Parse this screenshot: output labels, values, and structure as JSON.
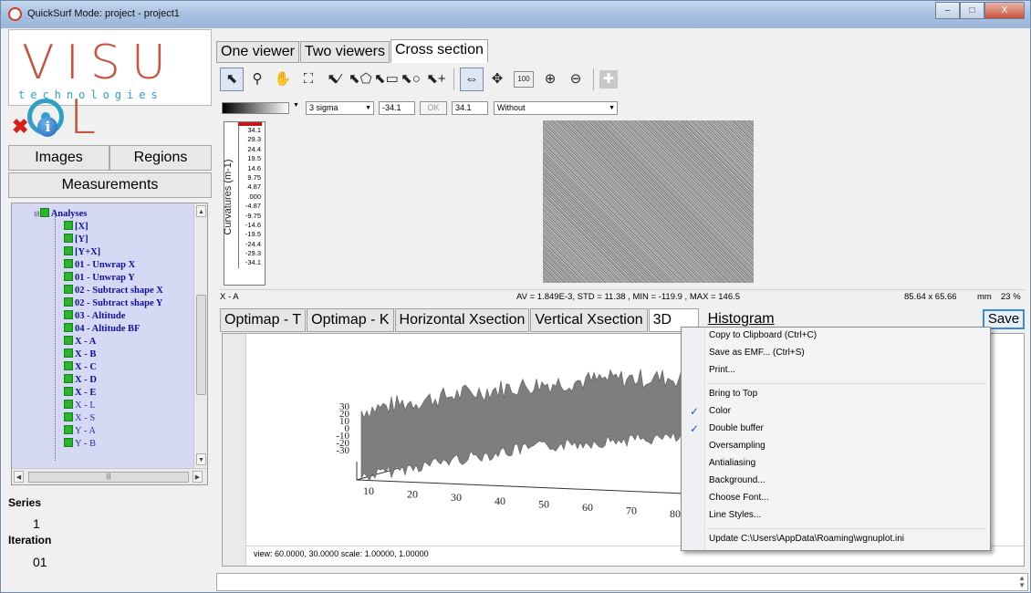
{
  "window": {
    "title": "QuickSurf Mode: project - project1",
    "buttons": {
      "minimize": "–",
      "maximize": "□",
      "close": "X"
    }
  },
  "sidebar": {
    "logo_main_left": "VISU",
    "logo_main_right": "L",
    "logo_sub": "technologies",
    "tabs": {
      "images": "Images",
      "regions": "Regions",
      "measurements": "Measurements"
    },
    "tree": {
      "root": "Analyses",
      "items": [
        "[X]",
        "[Y]",
        "[Y+X]",
        "01 - Unwrap X",
        "01 - Unwrap Y",
        "02 - Subtract shape X",
        "02 - Subtract shape Y",
        "03 - Altitude",
        "04 - Altitude BF",
        "X - A",
        "X - B",
        "X - C",
        "X - D",
        "X - E",
        "X - L",
        "X - S",
        "Y - A",
        "Y - B"
      ]
    },
    "series_label": "Series",
    "series_value": "1",
    "iteration_label": "Iteration",
    "iteration_value": "01"
  },
  "main": {
    "tabs": [
      "One viewer",
      "Two viewers",
      "Cross section"
    ],
    "active_tab": "Cross section",
    "toolbar_text_button": "100",
    "options": {
      "sigma": "3 sigma",
      "min": "-34.1",
      "ok": "OK",
      "max": "34.1",
      "filter": "Without"
    },
    "colorbar": {
      "label": "Curvatures (m-1)",
      "ticks": [
        "34.1",
        "29.3",
        "24.4",
        "19.5",
        "14.6",
        "9.75",
        "4.87",
        ".000",
        "-4.87",
        "-9.75",
        "-14.6",
        "-19.5",
        "-24.4",
        "-29.3",
        "-34.1"
      ]
    },
    "status": {
      "left": "X - A",
      "stats": "AV = 1.849E-3, STD = 11.38 , MIN = -119.9 , MAX = 146.5",
      "size": "85.64 x 65.66",
      "unit": "mm",
      "zoom": "23 %"
    },
    "subtabs": [
      "Optimap - T",
      "Optimap - K",
      "Horizontal Xsection",
      "Vertical Xsection",
      "3D",
      "Histogram"
    ],
    "active_subtab": "3D",
    "save_label": "Save",
    "plot": {
      "z_ticks": [
        "30",
        "20",
        "10",
        "0",
        "-10",
        "-20",
        "-30"
      ],
      "x_ticks": [
        "10",
        "20",
        "30",
        "40",
        "50",
        "60",
        "70",
        "80"
      ],
      "view_text": "view: 60.0000, 30.0000  scale: 1.00000, 1.00000"
    }
  },
  "context_menu": {
    "items": [
      {
        "label": "Copy to Clipboard (Ctrl+C)",
        "checked": false
      },
      {
        "label": "Save as EMF... (Ctrl+S)",
        "checked": false
      },
      {
        "label": "Print...",
        "checked": false
      },
      {
        "label": "Bring to Top",
        "checked": false
      },
      {
        "label": "Color",
        "checked": true
      },
      {
        "label": "Double buffer",
        "checked": true
      },
      {
        "label": "Oversampling",
        "checked": false
      },
      {
        "label": "Antialiasing",
        "checked": false
      },
      {
        "label": "Background...",
        "checked": false
      },
      {
        "label": "Choose Font...",
        "checked": false
      },
      {
        "label": "Line Styles...",
        "checked": false
      },
      {
        "label": "Update C:\\Users\\AppData\\Roaming\\wgnuplot.ini",
        "checked": false
      }
    ],
    "check_glyph": "✓"
  },
  "colors": {
    "brand_red": "#c9523e",
    "brand_blue": "#2ea0c8",
    "tree_bg": "#d6d9f4",
    "tree_text": "#1010a0",
    "node_green": "#2ab52a"
  }
}
